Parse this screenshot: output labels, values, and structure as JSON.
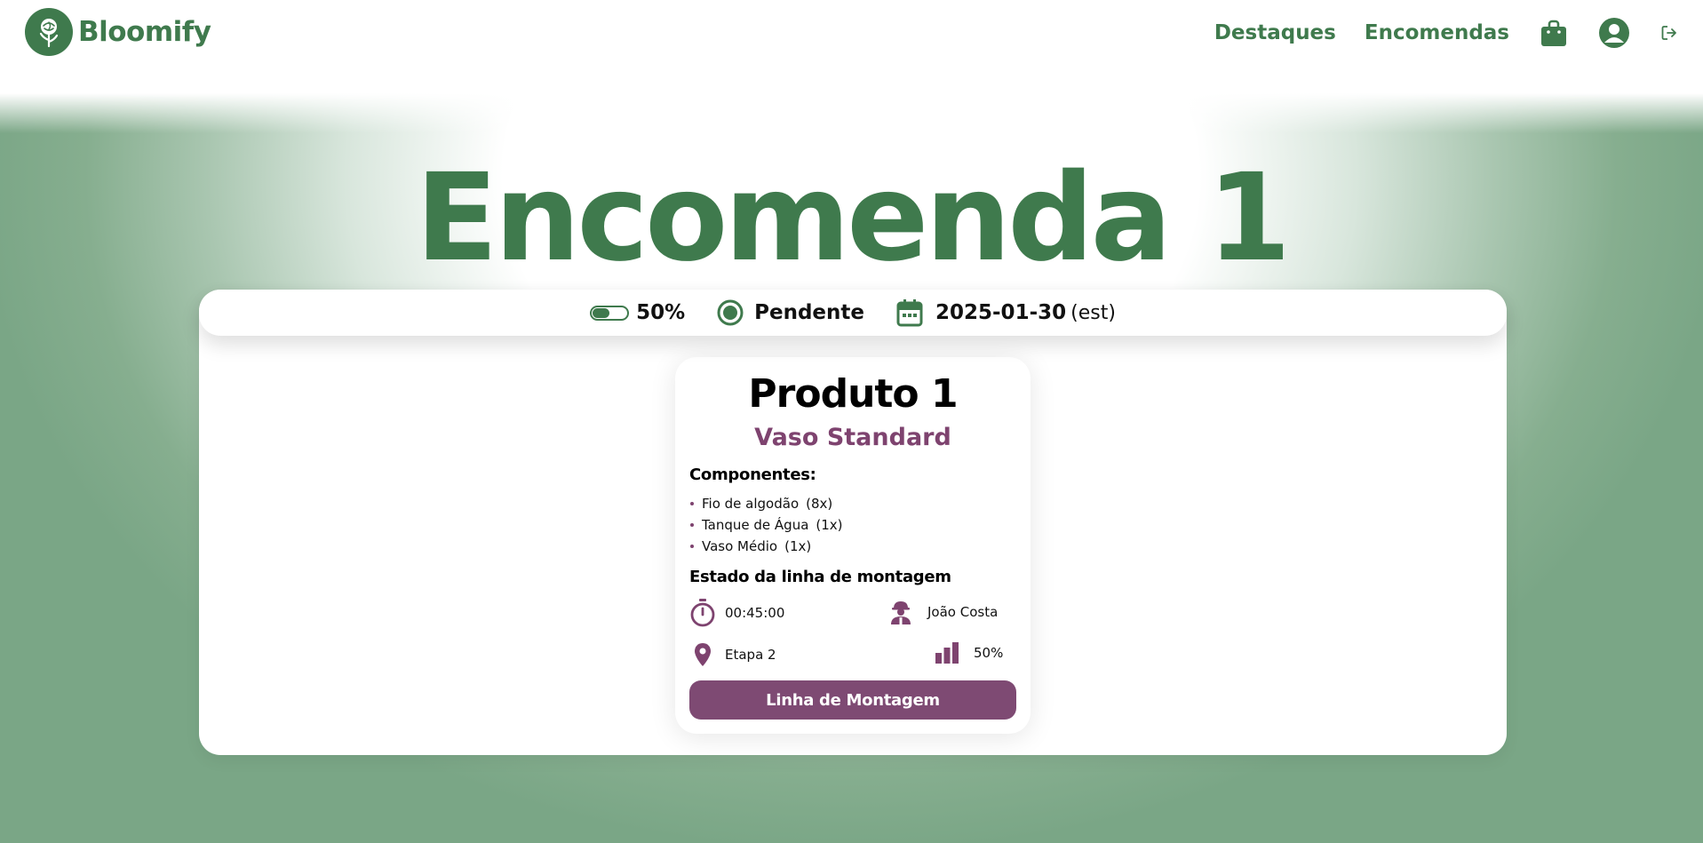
{
  "brand": {
    "name": "Bloomify"
  },
  "nav": {
    "links": [
      {
        "label": "Destaques"
      },
      {
        "label": "Encomendas"
      }
    ],
    "icons": [
      "shopping-bag-icon",
      "user-account-icon",
      "logout-icon"
    ]
  },
  "page": {
    "title": "Encomenda 1"
  },
  "order_status": {
    "progress_label": "50%",
    "progress_fraction": 0.5,
    "state": "Pendente",
    "date": "2025-01-30",
    "date_suffix": "(est)"
  },
  "product": {
    "title": "Produto 1",
    "subtitle": "Vaso Standard",
    "components_heading": "Componentes:",
    "components": [
      {
        "name": "Fio de algodão",
        "qty": "(8x)"
      },
      {
        "name": "Tanque de Água",
        "qty": "(1x)"
      },
      {
        "name": "Vaso Médio",
        "qty": "(1x)"
      }
    ],
    "assembly_heading": "Estado da linha de montagem",
    "assembly": {
      "time": "00:45:00",
      "worker": "João Costa",
      "stage": "Etapa 2",
      "progress": "50%"
    },
    "button_label": "Linha de Montagem"
  },
  "colors": {
    "brand_green": "#3f7a4d",
    "accent_purple": "#7e436f",
    "button_purple": "#7e4a73"
  }
}
